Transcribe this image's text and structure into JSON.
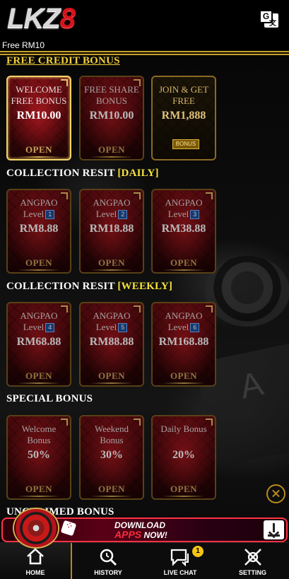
{
  "header": {
    "logo_text": "LKZ",
    "logo_num": "8",
    "translate_label": "G",
    "translate_sub": "文"
  },
  "marquee": {
    "text": "Free RM10"
  },
  "sections": {
    "free_credit": {
      "title": "FREE CREDIT BONUS"
    },
    "daily": {
      "title": "COLLECTION RESIT ",
      "tag": "[DAILY]"
    },
    "weekly": {
      "title": "COLLECTION RESIT ",
      "tag": "[WEEKLY]"
    },
    "special": {
      "title": "SPECIAL BONUS"
    },
    "unclaimed": {
      "title": "UNCLAIMED BONUS"
    }
  },
  "free_credit_cards": [
    {
      "line1": "WELCOME",
      "line2": "FREE BONUS",
      "amount": "RM10.00",
      "action": "OPEN"
    },
    {
      "line1": "FREE SHARE",
      "line2": "BONUS",
      "amount": "RM10.00",
      "action": "OPEN"
    },
    {
      "line1": "JOIN & GET",
      "line2": "FREE",
      "amount": "RM1,888",
      "badge": "BONUS"
    }
  ],
  "daily_cards": [
    {
      "line1": "ANGPAO",
      "level_label": "Level",
      "level": "1",
      "amount": "RM8.88",
      "action": "OPEN"
    },
    {
      "line1": "ANGPAO",
      "level_label": "Level",
      "level": "2",
      "amount": "RM18.88",
      "action": "OPEN"
    },
    {
      "line1": "ANGPAO",
      "level_label": "Level",
      "level": "3",
      "amount": "RM38.88",
      "action": "OPEN"
    }
  ],
  "weekly_cards": [
    {
      "line1": "ANGPAO",
      "level_label": "Level",
      "level": "4",
      "amount": "RM68.88",
      "action": "OPEN"
    },
    {
      "line1": "ANGPAO",
      "level_label": "Level",
      "level": "5",
      "amount": "RM88.88",
      "action": "OPEN"
    },
    {
      "line1": "ANGPAO",
      "level_label": "Level",
      "level": "6",
      "amount": "RM168.88",
      "action": "OPEN"
    }
  ],
  "special_cards": [
    {
      "line1": "Welcome",
      "line2": "Bonus",
      "amount": "50%",
      "action": "OPEN"
    },
    {
      "line1": "Weekend",
      "line2": "Bonus",
      "amount": "30%",
      "action": "OPEN"
    },
    {
      "line1": "Daily Bonus",
      "line2": "",
      "amount": "20%",
      "action": "OPEN"
    }
  ],
  "download_banner": {
    "line1": "DOWNLOAD",
    "apps": "APPS",
    "now": " NOW!"
  },
  "nav": {
    "home": "HOME",
    "history": "HISTORY",
    "live_chat": "LIVE CHAT",
    "live_chat_badge": "1",
    "setting": "SETTING"
  },
  "colors": {
    "accent_gold": "#c9a227",
    "card_red": "#6a0d12",
    "banner_red": "#ff3344"
  }
}
